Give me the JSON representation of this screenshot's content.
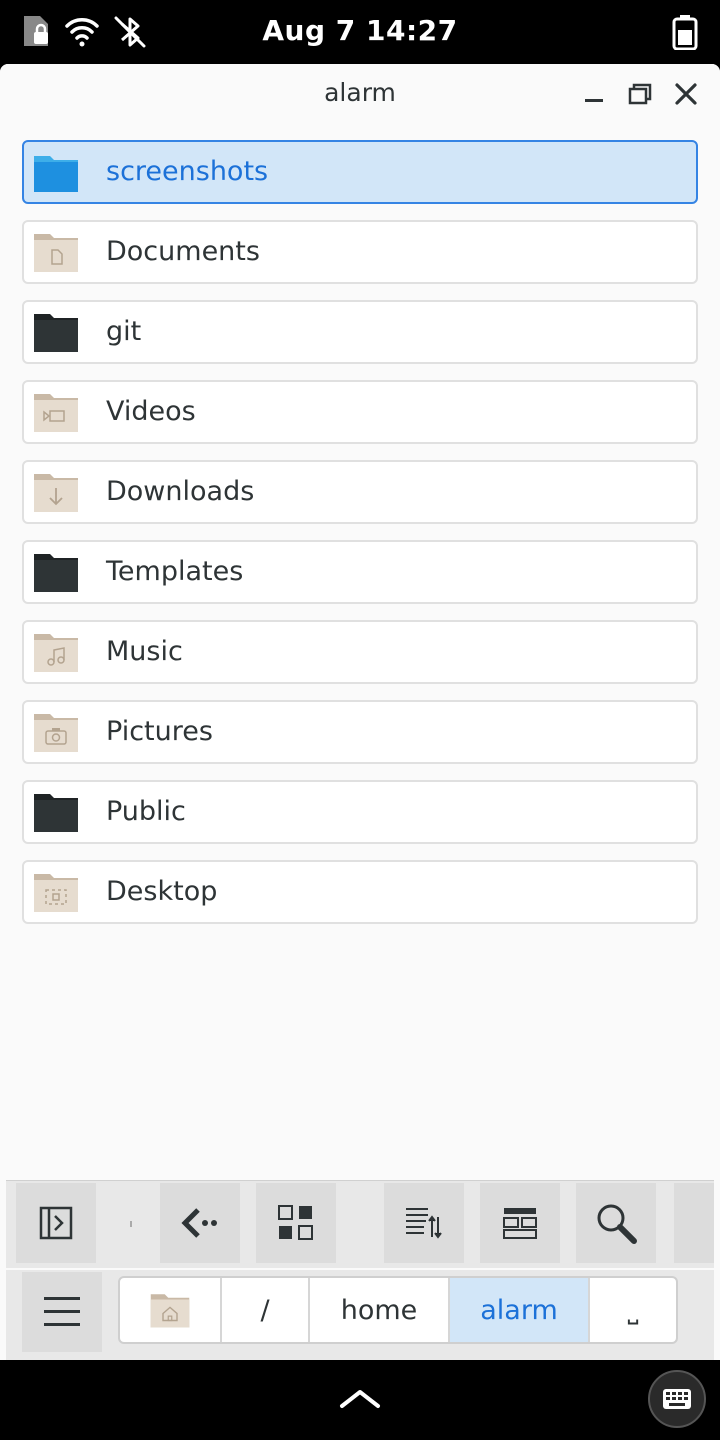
{
  "status": {
    "date": "Aug 7",
    "time": "14:27",
    "icons": [
      "sim-lock-icon",
      "wifi-icon",
      "bluetooth-disabled-icon",
      "battery-icon"
    ]
  },
  "window": {
    "title": "alarm"
  },
  "files": [
    {
      "name": "screenshots",
      "icon": "folder-blue-icon",
      "selected": true
    },
    {
      "name": "Documents",
      "icon": "folder-documents-icon"
    },
    {
      "name": "git",
      "icon": "folder-dark-icon"
    },
    {
      "name": "Videos",
      "icon": "folder-videos-icon"
    },
    {
      "name": "Downloads",
      "icon": "folder-download-icon"
    },
    {
      "name": "Templates",
      "icon": "folder-dark-icon"
    },
    {
      "name": "Music",
      "icon": "folder-music-icon"
    },
    {
      "name": "Pictures",
      "icon": "folder-pictures-icon"
    },
    {
      "name": "Public",
      "icon": "folder-dark-icon"
    },
    {
      "name": "Desktop",
      "icon": "folder-desktop-icon"
    }
  ],
  "toolbar": {
    "buttons": [
      "sidebar-toggle-icon",
      "back-icon",
      "grid-view-icon",
      "sort-icon",
      "list-view-icon",
      "search-icon"
    ]
  },
  "pathbar": {
    "crumbs": [
      "/",
      "home",
      "alarm",
      "⎵"
    ]
  },
  "colors": {
    "accent": "#1c71d8",
    "selected_bg": "#d2e6f8",
    "folder_dark": "#2e3436",
    "folder_tan": "#d9cfc1"
  }
}
